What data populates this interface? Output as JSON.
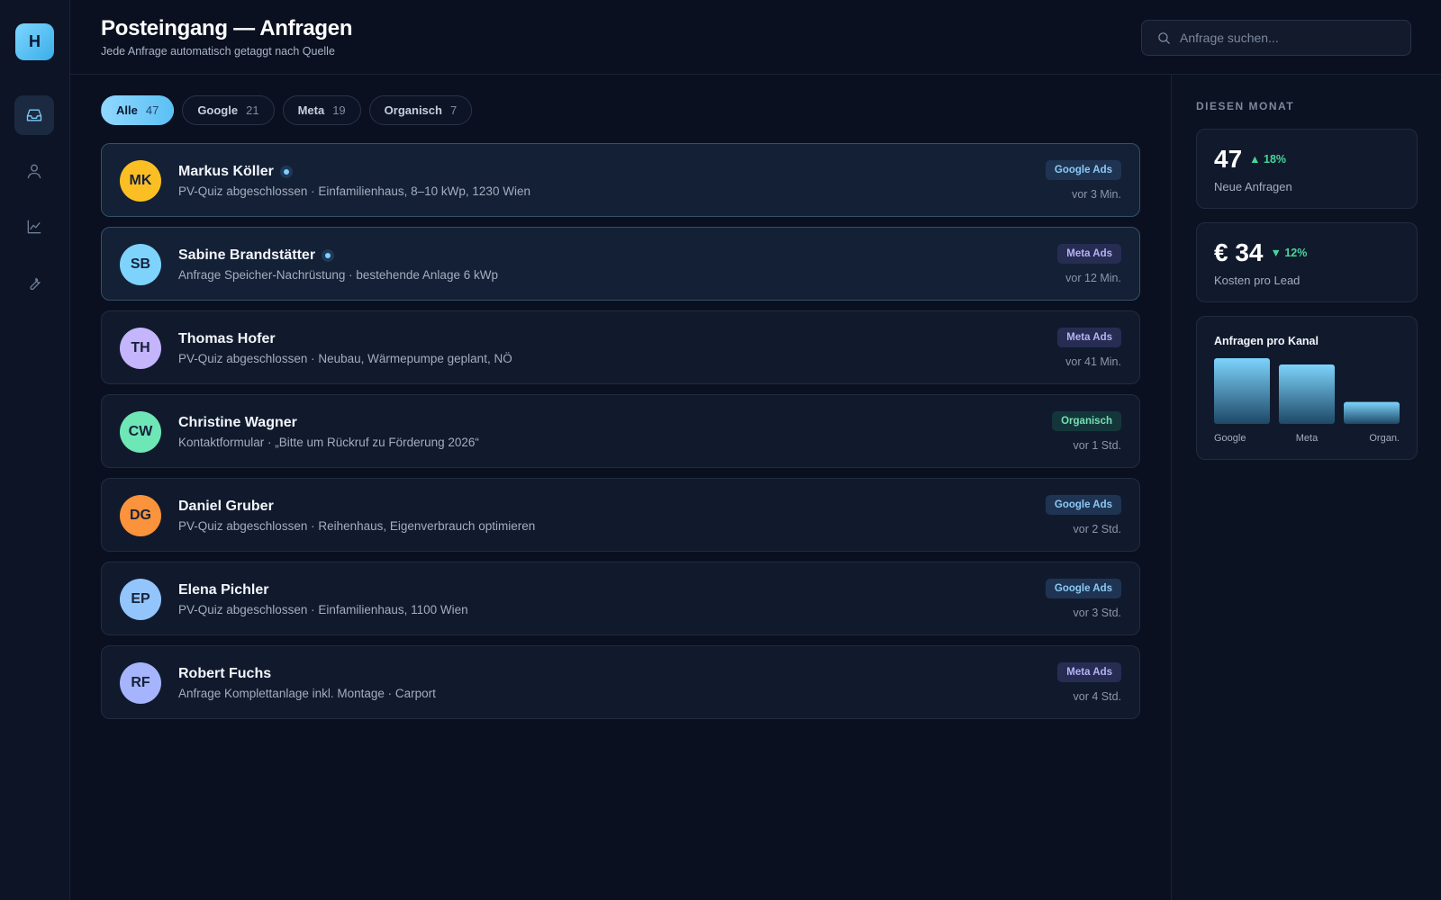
{
  "app": {
    "logo_letter": "H"
  },
  "sidebar": {
    "items": [
      {
        "name": "inbox",
        "icon": "inbox-icon",
        "active": true
      },
      {
        "name": "contacts",
        "icon": "user-icon",
        "active": false
      },
      {
        "name": "analytics",
        "icon": "chart-line-icon",
        "active": false
      },
      {
        "name": "tools",
        "icon": "wrench-icon",
        "active": false
      }
    ]
  },
  "header": {
    "title": "Posteingang — Anfragen",
    "subtitle": "Jede Anfrage automatisch getaggt nach Quelle",
    "search_placeholder": "Anfrage suchen..."
  },
  "filters": [
    {
      "label": "Alle",
      "count": "47",
      "active": true
    },
    {
      "label": "Google",
      "count": "21",
      "active": false
    },
    {
      "label": "Meta",
      "count": "19",
      "active": false
    },
    {
      "label": "Organisch",
      "count": "7",
      "active": false
    }
  ],
  "leads": [
    {
      "initials": "MK",
      "name": "Markus Köller",
      "unread": true,
      "desc": "PV-Quiz abgeschlossen · Einfamilienhaus, 8–10 kWp, 1230 Wien",
      "source": "Google Ads",
      "source_type": "google",
      "time": "vor 3 Min.",
      "avatar_color": "#fbbf24"
    },
    {
      "initials": "SB",
      "name": "Sabine Brandstätter",
      "unread": true,
      "desc": "Anfrage Speicher-Nachrüstung · bestehende Anlage 6 kWp",
      "source": "Meta Ads",
      "source_type": "meta",
      "time": "vor 12 Min.",
      "avatar_color": "#7dd3fc"
    },
    {
      "initials": "TH",
      "name": "Thomas Hofer",
      "unread": false,
      "desc": "PV-Quiz abgeschlossen · Neubau, Wärmepumpe geplant, NÖ",
      "source": "Meta Ads",
      "source_type": "meta",
      "time": "vor 41 Min.",
      "avatar_color": "#c4b5fd"
    },
    {
      "initials": "CW",
      "name": "Christine Wagner",
      "unread": false,
      "desc": "Kontaktformular · „Bitte um Rückruf zu Förderung 2026“",
      "source": "Organisch",
      "source_type": "organisch",
      "time": "vor 1 Std.",
      "avatar_color": "#6ee7b7"
    },
    {
      "initials": "DG",
      "name": "Daniel Gruber",
      "unread": false,
      "desc": "PV-Quiz abgeschlossen · Reihenhaus, Eigenverbrauch optimieren",
      "source": "Google Ads",
      "source_type": "google",
      "time": "vor 2 Std.",
      "avatar_color": "#fb923c"
    },
    {
      "initials": "EP",
      "name": "Elena Pichler",
      "unread": false,
      "desc": "PV-Quiz abgeschlossen · Einfamilienhaus, 1100 Wien",
      "source": "Google Ads",
      "source_type": "google",
      "time": "vor 3 Std.",
      "avatar_color": "#93c5fd"
    },
    {
      "initials": "RF",
      "name": "Robert Fuchs",
      "unread": false,
      "desc": "Anfrage Komplettanlage inkl. Montage · Carport",
      "source": "Meta Ads",
      "source_type": "meta",
      "time": "vor 4 Std.",
      "avatar_color": "#a5b4fc"
    }
  ],
  "stats": {
    "section_label": "DIESEN MONAT",
    "new_leads": {
      "value": "47",
      "delta": "▲ 18%",
      "label": "Neue Anfragen"
    },
    "cost_per_lead": {
      "value": "€ 34",
      "delta": "▼ 12%",
      "label": "Kosten pro Lead"
    }
  },
  "colors": {
    "accent": "#7cc9f5",
    "delta_positive": "#49d49a",
    "bar_top": "#7dd3fc",
    "bar_bottom": "#1e4866"
  },
  "chart_data": {
    "type": "bar",
    "title": "Anfragen pro Kanal",
    "categories": [
      "Google",
      "Meta",
      "Organ."
    ],
    "values": [
      21,
      19,
      7
    ],
    "ylim": [
      0,
      21
    ],
    "grid": false,
    "xlabel": "",
    "ylabel": ""
  }
}
